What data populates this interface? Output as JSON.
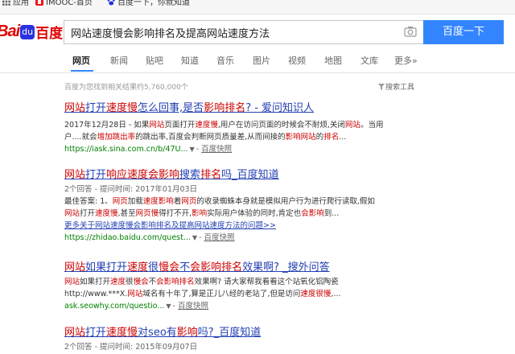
{
  "bookmarks": [
    {
      "label": "应用",
      "icon": "apps-grid-icon"
    },
    {
      "label": "IMOOC-首页",
      "icon": "imooc-favicon-icon"
    },
    {
      "label": "百度一下，你就知道",
      "icon": "baidu-paw-icon"
    }
  ],
  "logo": {
    "latin": "Bai",
    "paw": "du",
    "chinese": "百度"
  },
  "search": {
    "query": "网站速度慢会影响排名及提高网站速度方法",
    "button": "百度一下",
    "camera_icon": "camera-icon"
  },
  "tabs": [
    {
      "label": "网页",
      "active": true
    },
    {
      "label": "新闻"
    },
    {
      "label": "贴吧"
    },
    {
      "label": "知道"
    },
    {
      "label": "音乐"
    },
    {
      "label": "图片"
    },
    {
      "label": "视频"
    },
    {
      "label": "地图"
    },
    {
      "label": "文库"
    },
    {
      "label": "更多»"
    }
  ],
  "result_count": "百度为您找到相关结果约5,760,000个",
  "search_tools": "搜索工具",
  "accent_color": "#3385ff",
  "results": [
    {
      "title": [
        [
          "网站",
          1
        ],
        [
          "打开",
          0
        ],
        [
          "速度慢",
          1
        ],
        [
          "怎么回事,是否",
          0
        ],
        [
          "影响排名",
          1
        ],
        [
          "? - 爱问知识人",
          0
        ]
      ],
      "lines": [
        [
          [
            "2017年12月28日 - 如果",
            0
          ],
          [
            "网站",
            1
          ],
          [
            "页面打开",
            0
          ],
          [
            "速度慢",
            1
          ],
          [
            ",用户在访问页面的时候会不耐烦,关闭",
            0
          ],
          [
            "网站",
            1
          ],
          [
            "。当用",
            0
          ]
        ],
        [
          [
            "户....就会",
            0
          ],
          [
            "增加跳出率",
            1
          ],
          [
            "的跳出率,百度会判断网页质量差,从而间接的",
            0
          ],
          [
            "影响网站",
            1
          ],
          [
            "的",
            0
          ],
          [
            "排名",
            1
          ],
          [
            "...",
            0
          ]
        ]
      ],
      "url": "https://iask.sina.com.cn/b/47U...",
      "snapshot": "百度快照"
    },
    {
      "title": [
        [
          "网站",
          1
        ],
        [
          "打开",
          0
        ],
        [
          "响应速度会影响",
          1
        ],
        [
          "搜索",
          0
        ],
        [
          "排名",
          1
        ],
        [
          "吗_百度知道",
          0
        ]
      ],
      "meta": "2个回答 - 提问时间: 2017年01月03日",
      "lines": [
        [
          [
            "最佳答案: 1、",
            0
          ],
          [
            "网页",
            1
          ],
          [
            "加载",
            0
          ],
          [
            "速度影响",
            1
          ],
          [
            "着",
            0
          ],
          [
            "网页",
            1
          ],
          [
            "的收录蜘蛛本身就是模拟用户行为进行爬行读取,假如",
            0
          ]
        ],
        [
          [
            "网站",
            1
          ],
          [
            "打开",
            0
          ],
          [
            "速度慢",
            1
          ],
          [
            ",甚至",
            0
          ],
          [
            "网页",
            1
          ],
          [
            "慢",
            1
          ],
          [
            "得打不开,",
            0
          ],
          [
            "影响",
            1
          ],
          [
            "实际用户体验的同时,肯定也",
            0
          ],
          [
            "会影响",
            1
          ],
          [
            "到...",
            0
          ]
        ]
      ],
      "more_link": "更多关于网站速度慢会影响排名及提高网站速度方法的问题>>",
      "url": "https://zhidao.baidu.com/quest...",
      "snapshot": "百度快照"
    },
    {
      "title": [
        [
          "网站",
          1
        ],
        [
          "如果打开",
          0
        ],
        [
          "速度",
          1
        ],
        [
          "很",
          0
        ],
        [
          "慢会",
          1
        ],
        [
          "不",
          0
        ],
        [
          "会影响排名",
          1
        ],
        [
          "效果啊? _搜外问答",
          0
        ]
      ],
      "lines": [
        [
          [
            "网站",
            1
          ],
          [
            "如果打开",
            0
          ],
          [
            "速度",
            1
          ],
          [
            "很",
            0
          ],
          [
            "慢会",
            1
          ],
          [
            "不",
            0
          ],
          [
            "会影响排名",
            1
          ],
          [
            "效果啊? 请大家帮我看看这个站氧化铝陶瓷",
            0
          ]
        ],
        [
          [
            "http://www.***X.",
            0
          ],
          [
            "网站",
            1
          ],
          [
            "域名有十年了,算是正儿八经的老站了,但是访问",
            0
          ],
          [
            "速度很慢",
            1
          ],
          [
            ",...",
            0
          ]
        ]
      ],
      "url": "ask.seowhy.com/questio...",
      "snapshot": "百度快照"
    },
    {
      "title": [
        [
          "网站",
          1
        ],
        [
          "打开",
          0
        ],
        [
          "速度慢",
          1
        ],
        [
          "对seo有",
          0
        ],
        [
          "影响",
          1
        ],
        [
          "吗?_百度知道",
          0
        ]
      ],
      "meta": "2个回答 - 提问时间: 2015年09月07日"
    }
  ]
}
